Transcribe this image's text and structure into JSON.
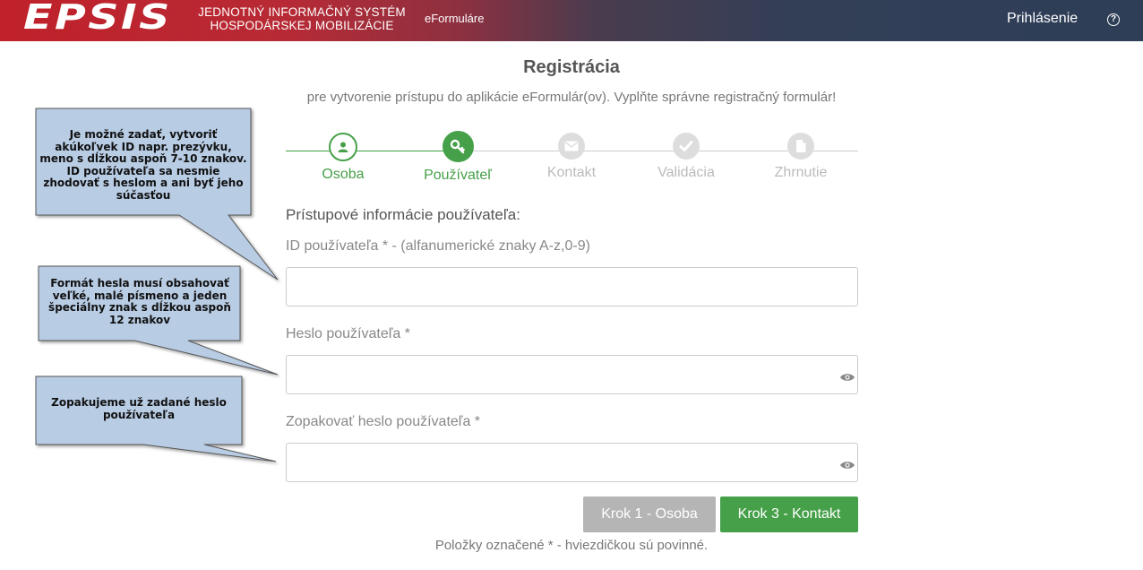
{
  "header": {
    "logo": "EPSIS",
    "system_title_line1": "JEDNOTNÝ INFORMAČNÝ SYSTÉM",
    "system_title_line2": "HOSPODÁRSKEJ MOBILIZÁCIE",
    "app_name": "eFormuláre",
    "login": "Prihlásenie",
    "help": "?"
  },
  "page": {
    "title": "Registrácia",
    "subtitle": "pre vytvorenie prístupu do aplikácie eFormulár(ov). Vyplňte správne registračný formulár!"
  },
  "steps": [
    {
      "label": "Osoba",
      "state": "done",
      "icon": "user-icon"
    },
    {
      "label": "Používateľ",
      "state": "active",
      "icon": "key-icon"
    },
    {
      "label": "Kontakt",
      "state": "todo",
      "icon": "envelope-icon"
    },
    {
      "label": "Validácia",
      "state": "todo",
      "icon": "check-icon"
    },
    {
      "label": "Zhrnutie",
      "state": "todo",
      "icon": "document-icon"
    }
  ],
  "form": {
    "section_title": "Prístupové informácie používateľa:",
    "user_id_label": "ID používateľa * - (alfanumerické znaky A-z,0-9)",
    "user_id_value": "",
    "password_label": "Heslo používateľa *",
    "password_value": "",
    "password_repeat_label": "Zopakovať heslo používateľa *",
    "password_repeat_value": ""
  },
  "buttons": {
    "back": "Krok 1 - Osoba",
    "next": "Krok 3 - Kontakt"
  },
  "footnote": "Položky označené * - hviezdičkou sú povinné.",
  "callouts": {
    "user_id_hint": "Je možné zadať, vytvoriť akúkoľvek ID napr. prezývku, meno s dĺžkou aspoň 7-10 znakov. ID používateľa sa nesmie zhodovať s heslom a ani byť jeho súčasťou",
    "password_hint": "Formát hesla musí obsahovať veľké, malé písmeno a jeden špeciálny znak s dĺžkou aspoň 12 znakov",
    "repeat_hint": "Zopakujeme už zadané heslo používateľa"
  },
  "colors": {
    "accent_green": "#46a049",
    "callout_fill": "#b8cce4",
    "header_red": "#c0212a",
    "header_navy": "#2e3e57"
  }
}
